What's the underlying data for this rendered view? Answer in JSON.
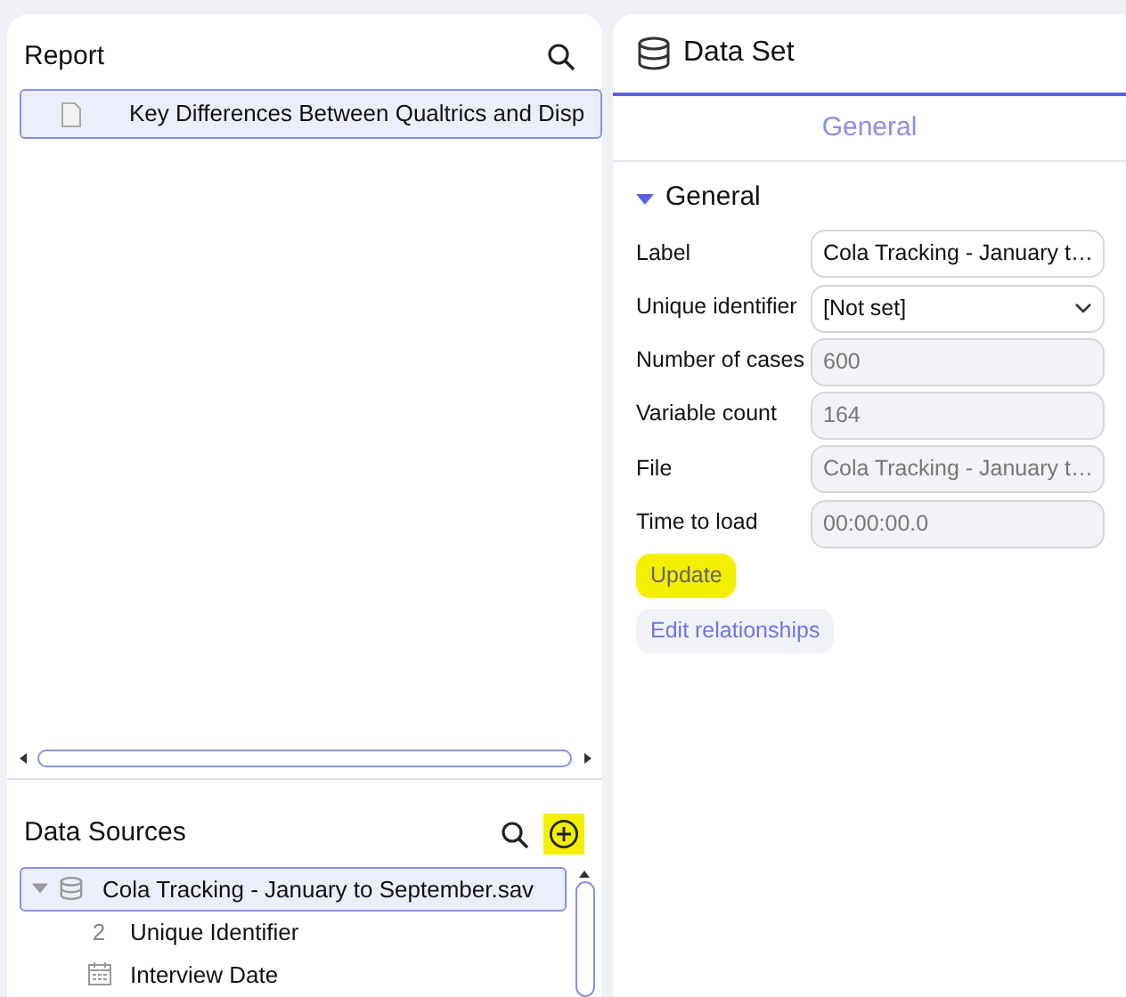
{
  "report": {
    "title": "Report",
    "items": [
      {
        "label": "Key Differences Between Qualtrics and Disp",
        "selected": true
      }
    ]
  },
  "data_sources": {
    "title": "Data Sources",
    "add_highlighted": true,
    "tree": [
      {
        "label": "Cola Tracking - January to September.sav",
        "selected": true,
        "expanded": true,
        "kind": "dataset",
        "children": [
          {
            "label": "Unique Identifier",
            "kind": "numeric",
            "glyph": "2",
            "selected": false
          },
          {
            "label": "Interview Date",
            "kind": "date",
            "selected": false
          }
        ]
      }
    ]
  },
  "data_set": {
    "title": "Data Set",
    "tabs": [
      {
        "label": "General",
        "selected": true
      }
    ],
    "section": {
      "title": "General",
      "expanded": true
    },
    "fields": [
      {
        "label": "Label",
        "kind": "text",
        "value": "Cola Tracking - January t…",
        "disabled": false
      },
      {
        "label": "Unique identifier",
        "kind": "select",
        "value": "[Not set]",
        "disabled": false
      },
      {
        "label": "Number of cases",
        "kind": "text",
        "value": "600",
        "disabled": true
      },
      {
        "label": "Variable count",
        "kind": "text",
        "value": "164",
        "disabled": true
      },
      {
        "label": "File",
        "kind": "text",
        "value": "Cola Tracking - January t…",
        "disabled": true
      },
      {
        "label": "Time to load",
        "kind": "text",
        "value": "00:00:00.0",
        "disabled": true
      }
    ],
    "buttons": [
      {
        "label": "Update",
        "highlighted": true
      },
      {
        "label": "Edit relationships",
        "highlighted": false
      }
    ]
  }
}
